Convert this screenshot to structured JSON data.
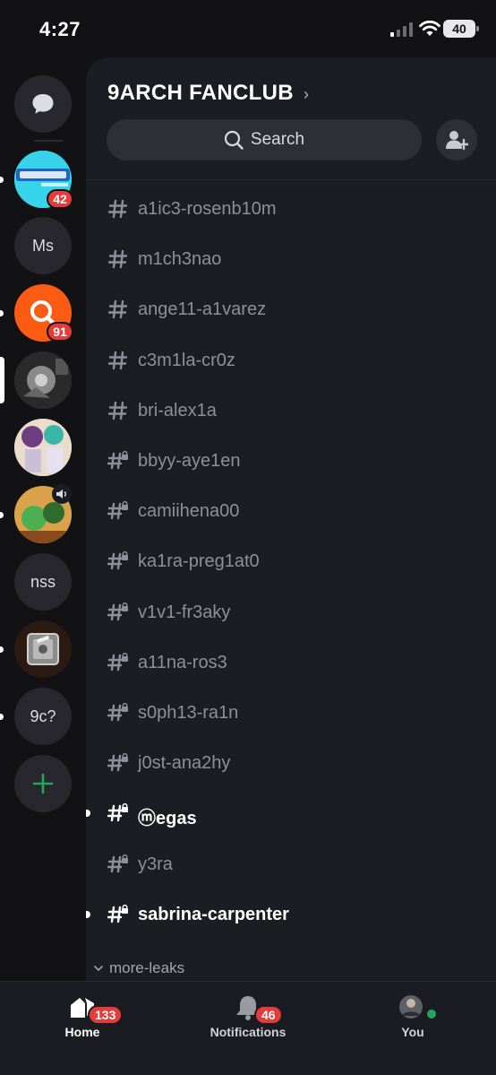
{
  "status_bar": {
    "time": "4:27",
    "battery": "40"
  },
  "server_rail": {
    "servers": [
      {
        "name": "direct-messages",
        "label": "",
        "badge": ""
      },
      {
        "name": "server-yourworld",
        "label": "",
        "badge": "42"
      },
      {
        "name": "server-ms",
        "label": "Ms",
        "badge": ""
      },
      {
        "name": "server-orange",
        "label": "",
        "badge": "91"
      },
      {
        "name": "server-selected",
        "label": "",
        "badge": ""
      },
      {
        "name": "server-anime",
        "label": "",
        "badge": ""
      },
      {
        "name": "server-cartoon",
        "label": "",
        "badge": ""
      },
      {
        "name": "server-nss",
        "label": "nss",
        "badge": ""
      },
      {
        "name": "server-safe",
        "label": "",
        "badge": ""
      },
      {
        "name": "server-9c",
        "label": "9c?",
        "badge": ""
      }
    ],
    "add_server": "+"
  },
  "guild": {
    "title": "9ARCH FANCLUB",
    "search_label": "Search"
  },
  "channels": [
    {
      "name": "a1ic3-rosenb10m",
      "type": "text",
      "unread": false
    },
    {
      "name": "m1ch3nao",
      "type": "text",
      "unread": false
    },
    {
      "name": "ange11-a1varez",
      "type": "text",
      "unread": false
    },
    {
      "name": "c3m1la-cr0z",
      "type": "text",
      "unread": false
    },
    {
      "name": "bri-alex1a",
      "type": "text",
      "unread": false
    },
    {
      "name": "bbyy-aye1en",
      "type": "locked",
      "unread": false
    },
    {
      "name": "camiihena00",
      "type": "locked",
      "unread": false
    },
    {
      "name": "ka1ra-preg1at0",
      "type": "locked",
      "unread": false
    },
    {
      "name": "v1v1-fr3aky",
      "type": "locked",
      "unread": false
    },
    {
      "name": "a11na-ros3",
      "type": "locked",
      "unread": false
    },
    {
      "name": "s0ph13-ra1n",
      "type": "locked",
      "unread": false
    },
    {
      "name": "j0st-ana2hy",
      "type": "locked",
      "unread": false
    },
    {
      "name": "ⓜegas",
      "type": "locked",
      "unread": true
    },
    {
      "name": "y3ra",
      "type": "locked",
      "unread": false
    },
    {
      "name": "sabrina-carpenter",
      "type": "locked",
      "unread": true
    }
  ],
  "category": {
    "label": "more-leaks"
  },
  "bottom_nav": {
    "home": {
      "label": "Home",
      "badge": "133"
    },
    "notifications": {
      "label": "Notifications",
      "badge": "46"
    },
    "you": {
      "label": "You"
    }
  },
  "colors": {
    "accent_red": "#e53b3b",
    "online_green": "#23a55a",
    "panel_bg": "#1c1d22",
    "rail_bg": "#121214"
  }
}
